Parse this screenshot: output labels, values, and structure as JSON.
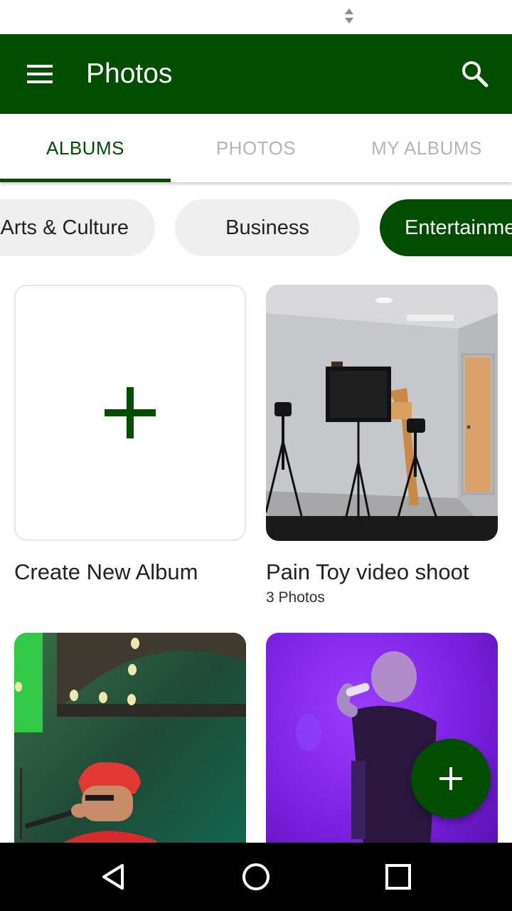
{
  "app_bar": {
    "title": "Photos",
    "menu_icon": "menu-icon",
    "search_icon": "search-icon",
    "color": "#004d00"
  },
  "tabs": [
    {
      "label": "ALBUMS",
      "active": true
    },
    {
      "label": "PHOTOS",
      "active": false
    },
    {
      "label": "MY ALBUMS",
      "active": false
    }
  ],
  "categories": [
    {
      "label": "Arts & Culture",
      "selected": false
    },
    {
      "label": "Business",
      "selected": false
    },
    {
      "label": "Entertainment",
      "selected": true
    }
  ],
  "albums": [
    {
      "title": "Create New Album",
      "count": "",
      "icon": "plus-icon"
    },
    {
      "title": "Pain Toy video shoot",
      "count": "3 Photos"
    },
    {
      "title": "",
      "count": ""
    },
    {
      "title": "",
      "count": ""
    }
  ],
  "fab": {
    "icon": "plus-icon"
  },
  "nav": {
    "back": "back-icon",
    "home": "home-icon",
    "recents": "recents-icon"
  },
  "colors": {
    "primary": "#004d00",
    "chip_bg": "#efefef",
    "inactive_tab": "#b5b5b5"
  }
}
